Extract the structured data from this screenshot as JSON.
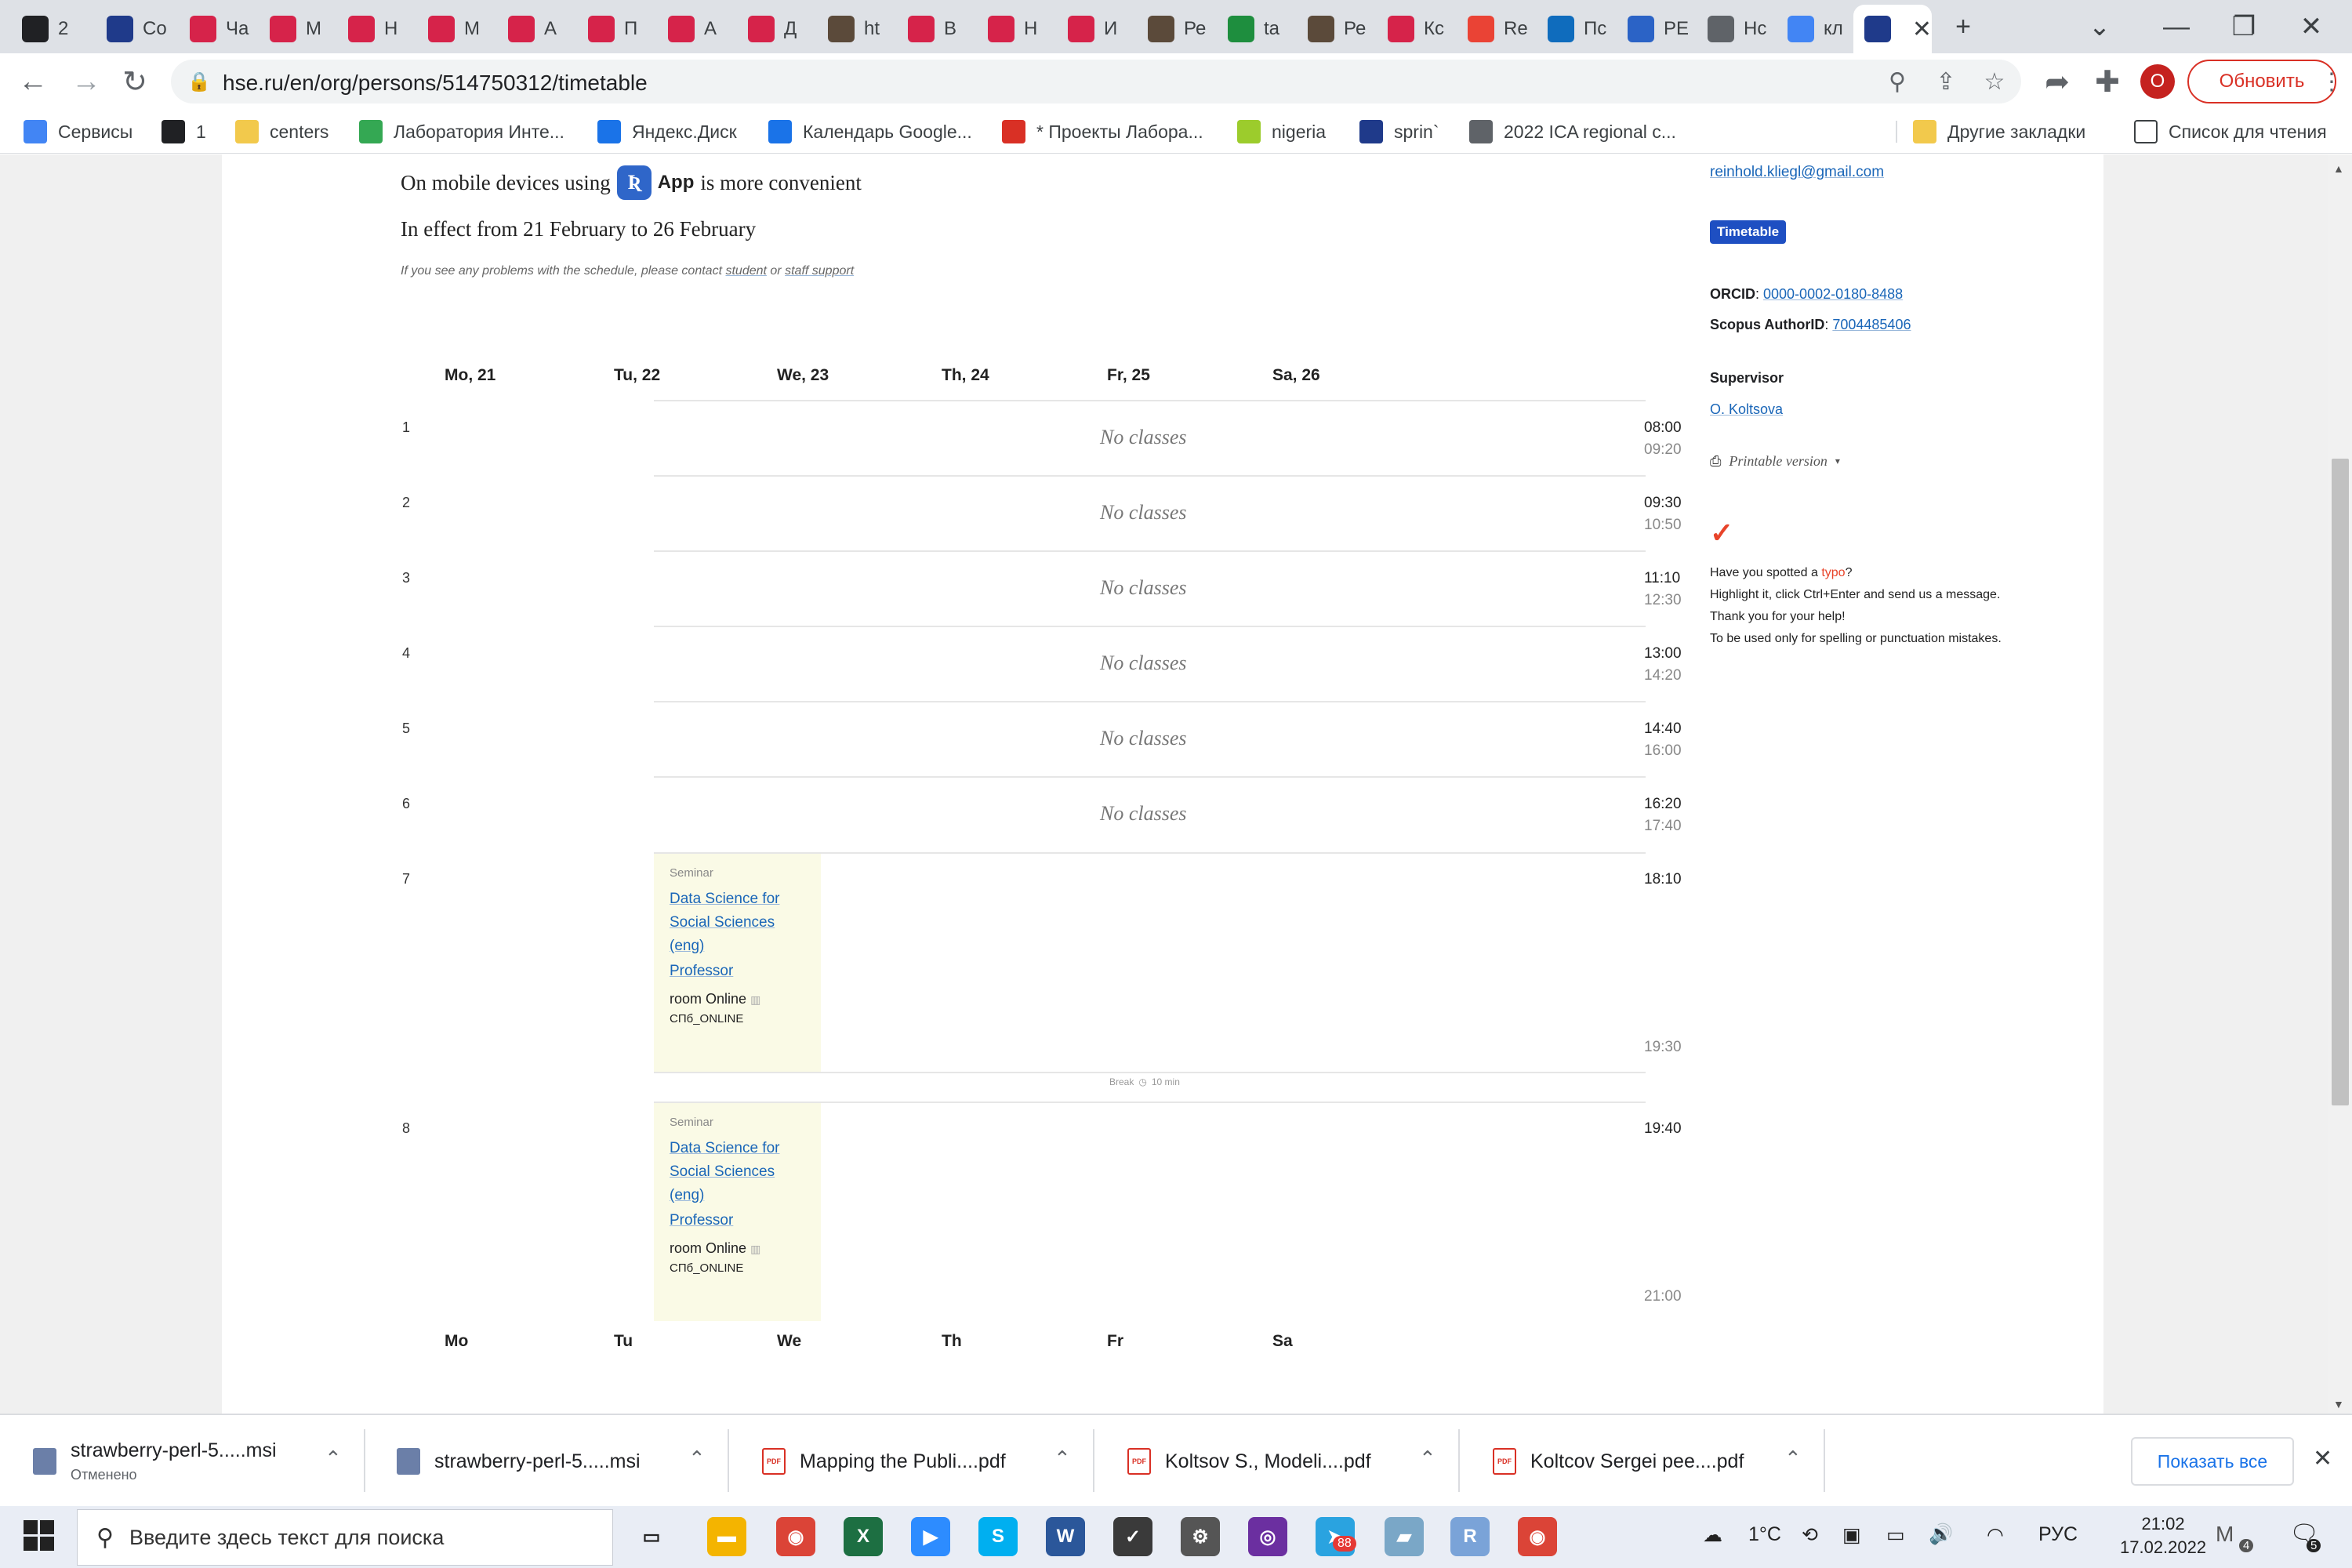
{
  "browser": {
    "tabs": [
      {
        "title": "2",
        "icon": "list-icon",
        "color": "#202124"
      },
      {
        "title": "Co",
        "icon": "hse-icon",
        "color": "#1f3a8a"
      },
      {
        "title": "Ча",
        "icon": "chat-icon",
        "color": "#d6234a"
      },
      {
        "title": "М",
        "icon": "mail-icon",
        "color": "#d6234a"
      },
      {
        "title": "Н",
        "icon": "mail-icon",
        "color": "#d6234a"
      },
      {
        "title": "М",
        "icon": "mail-icon",
        "color": "#d6234a"
      },
      {
        "title": "А",
        "icon": "mail-icon",
        "color": "#d6234a"
      },
      {
        "title": "П",
        "icon": "mail-icon",
        "color": "#d6234a"
      },
      {
        "title": "А",
        "icon": "chat-icon",
        "color": "#d6234a"
      },
      {
        "title": "Д",
        "icon": "mail-icon",
        "color": "#d6234a"
      },
      {
        "title": "ht",
        "icon": "raccoon-icon",
        "color": "#5b4a3a"
      },
      {
        "title": "В",
        "icon": "mail-icon",
        "color": "#d6234a"
      },
      {
        "title": "Н",
        "icon": "mail-icon",
        "color": "#d6234a"
      },
      {
        "title": "И",
        "icon": "mail-icon",
        "color": "#d6234a"
      },
      {
        "title": "Ре",
        "icon": "raccoon-icon",
        "color": "#5b4a3a"
      },
      {
        "title": "ta",
        "icon": "leaf-icon",
        "color": "#1e8e3e"
      },
      {
        "title": "Ре",
        "icon": "raccoon-icon",
        "color": "#5b4a3a"
      },
      {
        "title": "Кс",
        "icon": "mail-icon",
        "color": "#d6234a"
      },
      {
        "title": "Re",
        "icon": "gmail-icon",
        "color": "#ea4335"
      },
      {
        "title": "Пс",
        "icon": "outlook-icon",
        "color": "#0f6cbd"
      },
      {
        "title": "РЕ",
        "icon": "grid-icon",
        "color": "#2b63c6"
      },
      {
        "title": "Нс",
        "icon": "chrome-icon",
        "color": "#5f6368"
      },
      {
        "title": "кл",
        "icon": "google-icon",
        "color": "#4285f4"
      },
      {
        "title": "",
        "icon": "hse-icon",
        "color": "#1f3a8a"
      }
    ],
    "url": "hse.ru/en/org/persons/514750312/timetable",
    "update_label": "Обновить",
    "profile_initial": "О",
    "bookmarks": [
      {
        "label": "Сервисы",
        "icon": "apps-icon",
        "color": "#4285f4"
      },
      {
        "label": "1",
        "icon": "globe-icon",
        "color": "#202124"
      },
      {
        "label": "centers",
        "icon": "folder-icon",
        "color": "#f2c94c"
      },
      {
        "label": "Лаборатория Инте...",
        "icon": "drive-icon",
        "color": "#34a853"
      },
      {
        "label": "Яндекс.Диск",
        "icon": "cloud-icon",
        "color": "#1a73e8"
      },
      {
        "label": "Календарь Google...",
        "icon": "calendar-icon",
        "color": "#1a73e8"
      },
      {
        "label": "* Проекты Лабора...",
        "icon": "project-icon",
        "color": "#d93025"
      },
      {
        "label": "nigeria",
        "icon": "w-icon",
        "color": "#9ccc2c"
      },
      {
        "label": "sprin`",
        "icon": "hse-icon",
        "color": "#1f3a8a"
      },
      {
        "label": "2022 ICA regional c...",
        "icon": "ica-icon",
        "color": "#5f6368"
      }
    ],
    "other_bookmarks": "Другие закладки",
    "reading_list": "Список для чтения"
  },
  "timetable": {
    "mobile_prefix": "On mobile devices using",
    "app_label": "App",
    "mobile_suffix": "is more convenient",
    "effect_text": "In effect from 21 February to 26 February",
    "problems_prefix": "If you see any problems with the schedule, please contact",
    "problems_link1": "student",
    "problems_or": "or",
    "problems_link2": "staff support",
    "days": [
      "Mo, 21",
      "Tu, 22",
      "We, 23",
      "Th, 24",
      "Fr, 25",
      "Sa, 26"
    ],
    "days_short": [
      "Mo",
      "Tu",
      "We",
      "Th",
      "Fr",
      "Sa"
    ],
    "slots": [
      {
        "num": "1",
        "start": "08:00",
        "end": "09:20",
        "text": "No classes"
      },
      {
        "num": "2",
        "start": "09:30",
        "end": "10:50",
        "text": "No classes"
      },
      {
        "num": "3",
        "start": "11:10",
        "end": "12:30",
        "text": "No classes"
      },
      {
        "num": "4",
        "start": "13:00",
        "end": "14:20",
        "text": "No classes"
      },
      {
        "num": "5",
        "start": "14:40",
        "end": "16:00",
        "text": "No classes"
      },
      {
        "num": "6",
        "start": "16:20",
        "end": "17:40",
        "text": "No classes"
      }
    ],
    "class_slots": [
      {
        "num": "7",
        "start": "18:10",
        "end": "19:30",
        "type": "Seminar",
        "title_lines": [
          "Data Science for",
          "Social Sciences",
          "(eng)"
        ],
        "role": "Professor",
        "room": "room Online",
        "code": "СПб_ONLINE"
      },
      {
        "num": "8",
        "start": "19:40",
        "end": "21:00",
        "type": "Seminar",
        "title_lines": [
          "Data Science for",
          "Social Sciences",
          "(eng)"
        ],
        "role": "Professor",
        "room": "room Online",
        "code": "СПб_ONLINE"
      }
    ],
    "break_text": "Break",
    "break_duration": "10 min"
  },
  "sidebar": {
    "email": "reinhold.kliegl@gmail.com",
    "timetable_badge": "Timetable",
    "orcid_label": "ORCID",
    "orcid_value": "0000-0002-0180-8488",
    "scopus_label": "Scopus AuthorID",
    "scopus_value": "7004485406",
    "supervisor_heading": "Supervisor",
    "supervisor_name": "O. Koltsova",
    "printable": "Printable version",
    "typo_prefix": "Have you spotted a",
    "typo_word": "typo",
    "typo_line2": "Highlight it, click Ctrl+Enter and send us a message.",
    "typo_line3": "Thank you for your help!",
    "typo_line4": "To be used only for spelling or punctuation mistakes."
  },
  "downloads": {
    "items": [
      {
        "name": "strawberry-perl-5.....msi",
        "status": "Отменено",
        "icon": "installer-icon"
      },
      {
        "name": "strawberry-perl-5.....msi",
        "status": "",
        "icon": "installer-icon"
      },
      {
        "name": "Mapping the Publi....pdf",
        "status": "",
        "icon": "pdf-icon"
      },
      {
        "name": "Koltsov S., Modeli....pdf",
        "status": "",
        "icon": "pdf-icon"
      },
      {
        "name": "Koltcov Sergei pee....pdf",
        "status": "",
        "icon": "pdf-icon"
      }
    ],
    "show_all": "Показать все"
  },
  "taskbar": {
    "search_placeholder": "Введите здесь текст для поиска",
    "telegram_badge": "88",
    "temperature": "1°C",
    "language": "РУС",
    "time": "21:02",
    "date": "17.02.2022",
    "notification_count": "5",
    "m_badge": "4"
  }
}
